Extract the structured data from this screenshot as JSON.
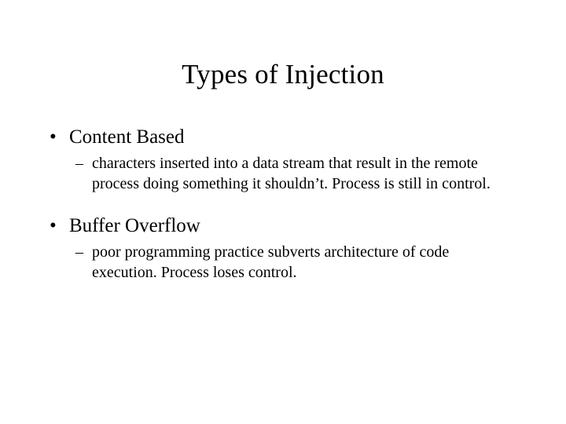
{
  "slide": {
    "title": "Types of Injection",
    "background_color": "#ffffff",
    "text_color": "#000000",
    "bullets": [
      {
        "marker": "•",
        "label": "Content Based",
        "sub": [
          {
            "marker": "–",
            "text": "characters inserted into a data stream that result in the remote process doing something it shouldn’t.  Process is still in control."
          }
        ]
      },
      {
        "marker": "•",
        "label": "Buffer Overflow",
        "sub": [
          {
            "marker": "–",
            "text": "poor programming practice subverts architecture of code execution.  Process loses control."
          }
        ]
      }
    ]
  }
}
